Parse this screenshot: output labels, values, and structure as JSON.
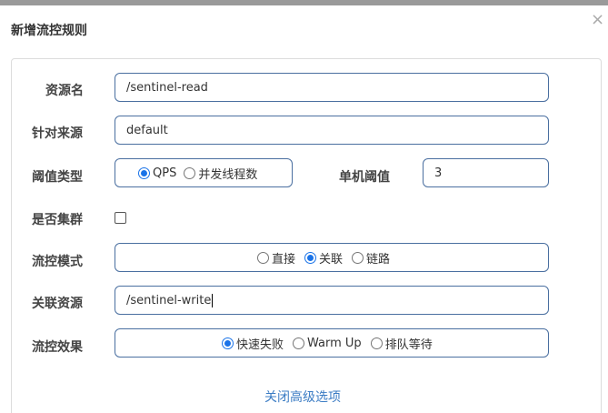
{
  "dialog": {
    "title": "新增流控规则",
    "close_symbol": "×"
  },
  "form": {
    "resource_name": {
      "label": "资源名",
      "value": "/sentinel-read"
    },
    "limit_app": {
      "label": "针对来源",
      "value": "default"
    },
    "threshold_type": {
      "label": "阈值类型",
      "options": [
        "QPS",
        "并发线程数"
      ],
      "selected": "QPS"
    },
    "single_threshold": {
      "label": "单机阈值",
      "value": "3"
    },
    "cluster": {
      "label": "是否集群",
      "checked": false
    },
    "flow_mode": {
      "label": "流控模式",
      "options": [
        "直接",
        "关联",
        "链路"
      ],
      "selected": "关联"
    },
    "ref_resource": {
      "label": "关联资源",
      "value": "/sentinel-write"
    },
    "control_behavior": {
      "label": "流控效果",
      "options": [
        "快速失败",
        "Warm Up",
        "排队等待"
      ],
      "selected": "快速失败"
    },
    "advanced_toggle": "关闭高级选项"
  },
  "colors": {
    "border": "#4a6fa0",
    "accent": "#1a73e8",
    "link": "#3b7cc4"
  }
}
